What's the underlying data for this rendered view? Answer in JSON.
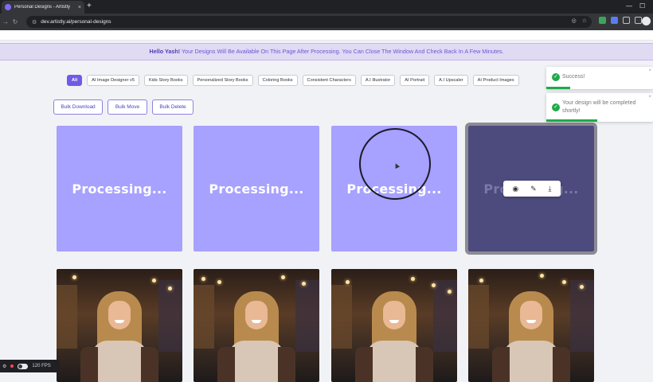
{
  "browser": {
    "tab_title": "Personal Designs - Artistly",
    "tab_close": "×",
    "new_tab": "+",
    "minimize": "—",
    "maximize": "☐",
    "url": "dev.artistly.ai/personal-designs"
  },
  "notice": {
    "greeting": "Hello Yash!",
    "message": " Your Designs Will Be Available On This Page After Processing. You Can Close The Window And Check Back In A Few Minutes."
  },
  "filters": [
    {
      "label": "All",
      "active": true
    },
    {
      "label": "AI Image Designer v5"
    },
    {
      "label": "Kids Story Books"
    },
    {
      "label": "Personalized Story Books"
    },
    {
      "label": "Coloring Books"
    },
    {
      "label": "Consistent Characters"
    },
    {
      "label": "A.I Illustrator"
    },
    {
      "label": "AI Portrait"
    },
    {
      "label": "A.I Upscaler"
    },
    {
      "label": "AI Product Images"
    }
  ],
  "bulk": {
    "download": "Bulk Download",
    "move": "Bulk Move",
    "delete": "Bulk Delete"
  },
  "cards": {
    "processing_label": "Processing..."
  },
  "toasts": {
    "success": "Success!",
    "completed": "Your design will be completed shortly!"
  },
  "overlay": {
    "fps": "120 FPS"
  },
  "colors": {
    "accent": "#6e5ce8",
    "processing_card": "#a7a1ff",
    "success_green": "#1faa4a"
  }
}
